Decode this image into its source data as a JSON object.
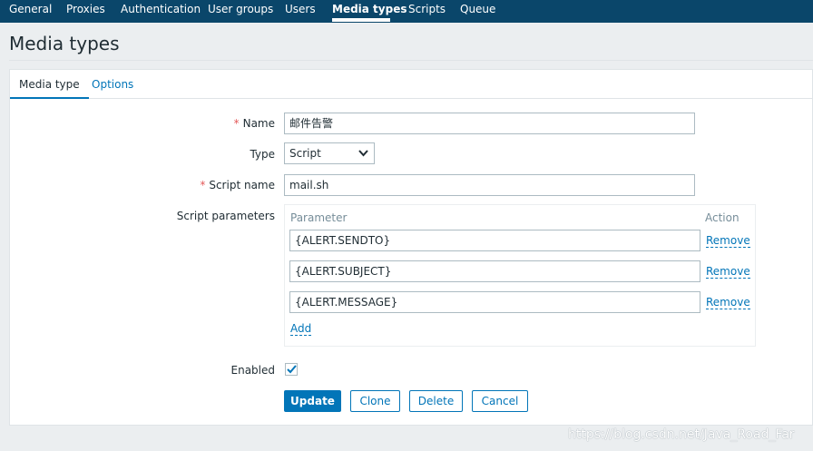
{
  "nav": {
    "items": [
      "General",
      "Proxies",
      "Authentication",
      "User groups",
      "Users",
      "Media types",
      "Scripts",
      "Queue"
    ],
    "active": "Media types"
  },
  "page": {
    "title": "Media types"
  },
  "tabs": {
    "media_type": "Media type",
    "options": "Options"
  },
  "form": {
    "required_mark": "*",
    "name_label": "Name",
    "name_value": "邮件告警",
    "type_label": "Type",
    "type_value": "Script",
    "script_name_label": "Script name",
    "script_name_value": "mail.sh",
    "script_params_label": "Script parameters",
    "params_header_parameter": "Parameter",
    "params_header_action": "Action",
    "params": [
      {
        "value": "{ALERT.SENDTO}",
        "action": "Remove"
      },
      {
        "value": "{ALERT.SUBJECT}",
        "action": "Remove"
      },
      {
        "value": "{ALERT.MESSAGE}",
        "action": "Remove"
      }
    ],
    "add_label": "Add",
    "enabled_label": "Enabled",
    "enabled": true
  },
  "buttons": {
    "update": "Update",
    "clone": "Clone",
    "delete": "Delete",
    "cancel": "Cancel"
  },
  "watermark": "https://blog.csdn.net/Java_Road_Far",
  "colors": {
    "nav_bg": "#0a466a",
    "accent": "#0275b8",
    "required": "#e45959"
  },
  "icons": {
    "select_arrow": "chevron-down-icon",
    "checkbox": "checkmark-icon"
  }
}
